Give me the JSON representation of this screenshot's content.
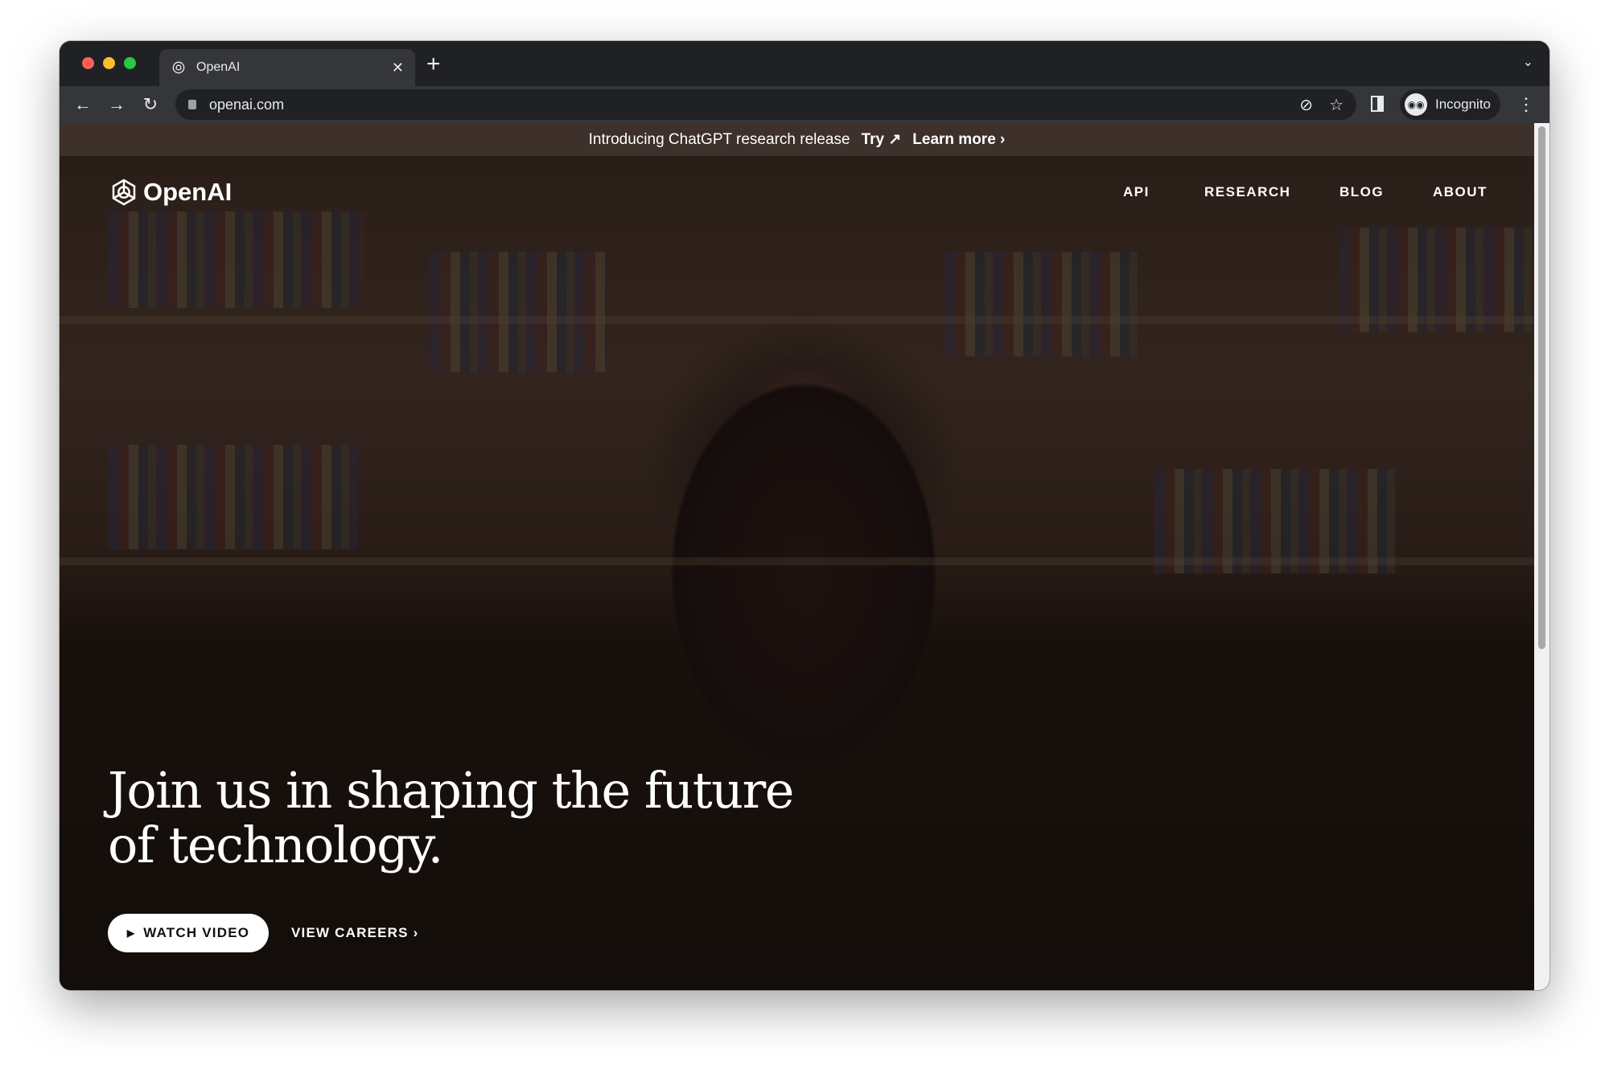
{
  "browser": {
    "tab_title": "OpenAI",
    "url": "openai.com",
    "profile_label": "Incognito",
    "traffic_colors": [
      "#ff5f57",
      "#febc2e",
      "#28c840"
    ]
  },
  "page": {
    "banner": {
      "text": "Introducing ChatGPT research release",
      "try_label": "Try ↗",
      "learn_label": "Learn more ›"
    },
    "logo_text": "OpenAI",
    "nav": [
      "API",
      "RESEARCH",
      "BLOG",
      "ABOUT"
    ],
    "hero": {
      "line1": "Join us in shaping the future",
      "line2": "of technology."
    },
    "watch_label": "WATCH VIDEO",
    "careers_label": "VIEW CAREERS ›"
  }
}
